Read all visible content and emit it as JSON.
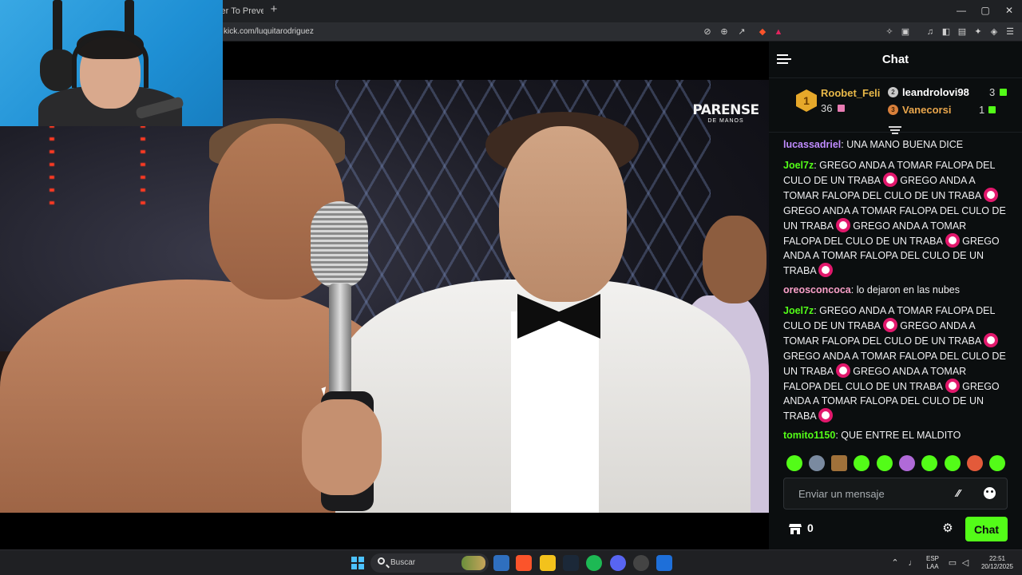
{
  "browser": {
    "tab_title": "ster To Preve",
    "new_tab": "+",
    "url": "kick.com/luquitarodriguez",
    "window_controls": {
      "minimize": "—",
      "maximize": "▢",
      "close": "✕"
    },
    "toolbar_icons": [
      "mute-icon",
      "zoom-icon",
      "share-icon",
      "brave-shield-icon",
      "rewards-icon",
      "extensions-icon",
      "wallet-icon",
      "media-icon",
      "sidebar-icon",
      "leo-icon",
      "vpn-icon",
      "menu-icon"
    ]
  },
  "video": {
    "logo_main": "PARENSE",
    "logo_sub": "DE MANOS"
  },
  "chat": {
    "title": "Chat",
    "leaderboard": [
      {
        "rank": "1",
        "name": "Roobet_Feli",
        "count": "36",
        "name_color": "#e9b949"
      },
      {
        "rank": "2",
        "name": "leandrolovi98",
        "count": "3",
        "name_color": "#ffffff"
      },
      {
        "rank": "3",
        "name": "Vanecorsi",
        "count": "1",
        "name_color": "#e9a64c"
      }
    ],
    "messages": [
      {
        "user": "lucassadriel",
        "user_color": "#c08cff",
        "text": "UNA MANO BUENA DICE"
      },
      {
        "user": "Joel7z",
        "user_color": "#53fc18",
        "lines": [
          "GREGO ANDA A TOMAR FALOPA DEL",
          "CULO DE UN TRABA",
          "GREGO ANDA A",
          "TOMAR FALOPA DEL CULO DE UN TRABA",
          "GREGO ANDA A TOMAR FALOPA DEL CULO DE",
          "UN TRABA",
          "GREGO ANDA A TOMAR",
          "FALOPA DEL CULO DE UN TRABA",
          "GREGO",
          "ANDA A TOMAR FALOPA DEL CULO DE UN",
          "TRABA"
        ]
      },
      {
        "user": "oreosconcoca",
        "user_color": "#f9a0c8",
        "text": "lo dejaron en las nubes"
      },
      {
        "user": "Joel7z",
        "user_color": "#53fc18"
      },
      {
        "user": "tomito1150",
        "user_color": "#53fc18",
        "text": "QUE ENTRE EL MALDITO PERXITAA"
      }
    ],
    "input_placeholder": "Enviar un mensaje",
    "points": "0",
    "send_label": "Chat",
    "accent": "#53fc18"
  },
  "taskbar": {
    "search_label": "Buscar",
    "language": "ESP",
    "layout": "LAA",
    "time": "22:51",
    "date": "20/12/2025",
    "apps": [
      "file-explorer-icon",
      "brave-icon",
      "folder-icon",
      "steam-icon",
      "spotify-icon",
      "discord-icon",
      "chatgpt-icon",
      "app-icon"
    ]
  }
}
